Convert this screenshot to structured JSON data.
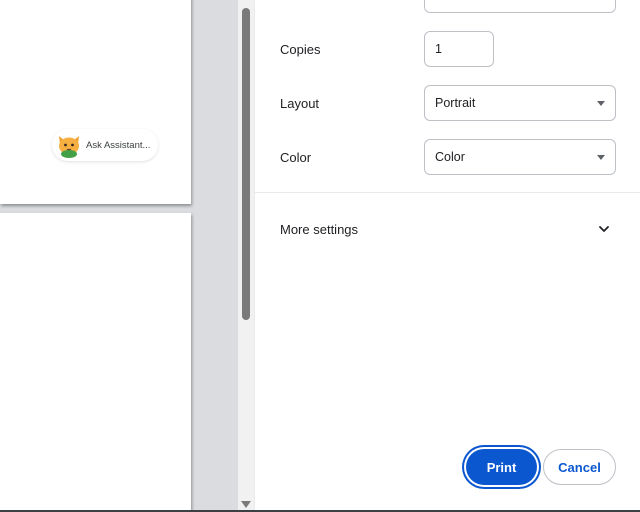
{
  "preview": {
    "assistant_chip": {
      "label": "Ask Assistant..."
    }
  },
  "settings": {
    "copies": {
      "label": "Copies",
      "value": "1"
    },
    "layout": {
      "label": "Layout",
      "value": "Portrait"
    },
    "color": {
      "label": "Color",
      "value": "Color"
    },
    "more_settings": {
      "label": "More settings"
    }
  },
  "actions": {
    "print_label": "Print",
    "cancel_label": "Cancel"
  },
  "colors": {
    "accent": "#0b57d0",
    "preview_background": "#dadce0"
  },
  "icons": {
    "assistant": "cat-icon",
    "expand": "chevron-down-icon",
    "dropdown": "caret-down-icon"
  }
}
